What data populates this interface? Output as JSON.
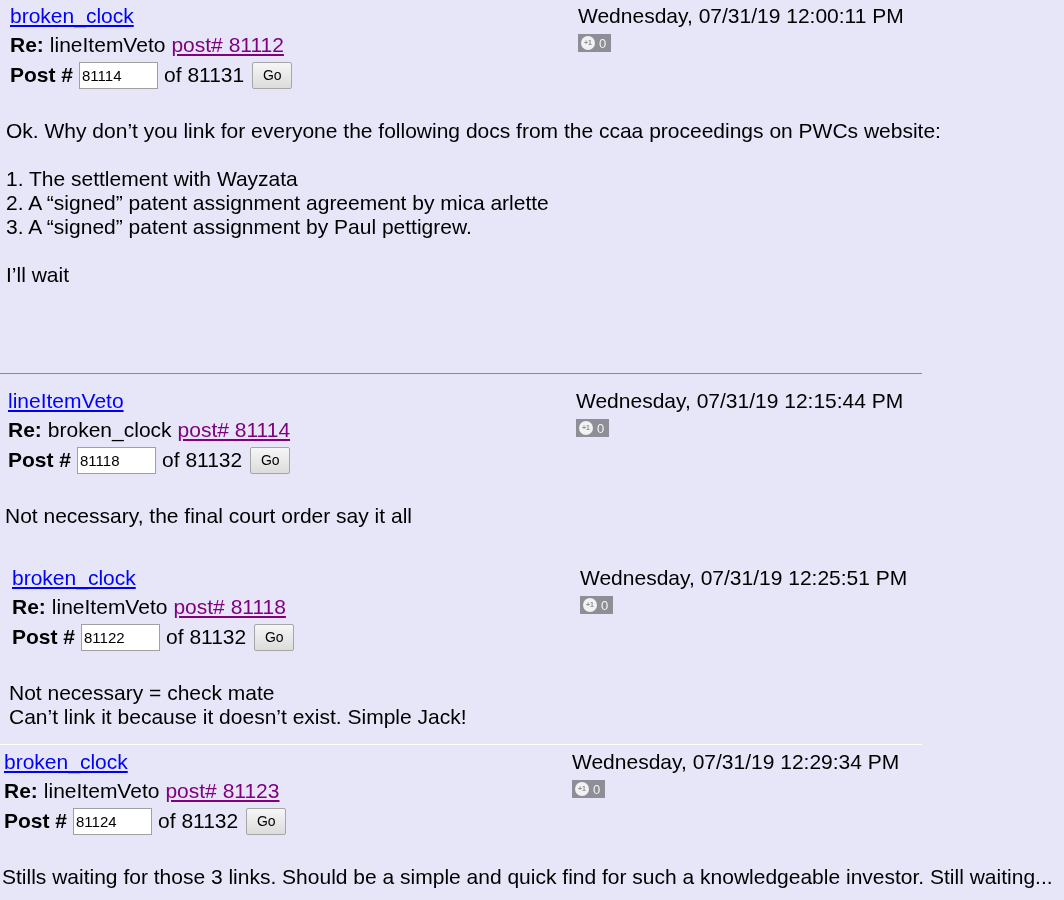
{
  "posts": [
    {
      "author": "broken_clock",
      "re_label": "Re:",
      "re_author": "lineItemVeto",
      "re_link": "post# 81112",
      "post_label": "Post #",
      "post_number": "81114",
      "of_text": "of 81131",
      "go": "Go",
      "date": "Wednesday, 07/31/19 12:00:11 PM",
      "plus_label": "+1",
      "plus_count": "0",
      "body": [
        [
          "Ok. Why don’t you link for everyone the following docs from the ccaa proceedings on PWCs website:"
        ],
        [
          "1. The settlement with Wayzata",
          "2. A “signed” patent assignment agreement by mica arlette",
          "3. A “signed” patent assignment by Paul pettigrew."
        ],
        [
          "I’ll wait"
        ]
      ],
      "divider": {
        "faint": false
      }
    },
    {
      "author": "lineItemVeto",
      "re_label": "Re:",
      "re_author": "broken_clock",
      "re_link": "post# 81114",
      "post_label": "Post #",
      "post_number": "81118",
      "of_text": "of 81132",
      "go": "Go",
      "date": "Wednesday, 07/31/19 12:15:44 PM",
      "plus_label": "+1",
      "plus_count": "0",
      "body": [
        [
          "Not necessary, the final court order say it all"
        ]
      ]
    },
    {
      "author": "broken_clock",
      "re_label": "Re:",
      "re_author": "lineItemVeto",
      "re_link": "post# 81118",
      "post_label": "Post #",
      "post_number": "81122",
      "of_text": "of 81132",
      "go": "Go",
      "date": "Wednesday, 07/31/19 12:25:51 PM",
      "plus_label": "+1",
      "plus_count": "0",
      "body": [
        [
          "Not necessary = check mate",
          "Can’t link it because it doesn’t exist. Simple Jack!"
        ]
      ],
      "divider": {
        "faint": true
      }
    },
    {
      "author": "broken_clock",
      "re_label": "Re:",
      "re_author": "lineItemVeto",
      "re_link": "post# 81123",
      "post_label": "Post #",
      "post_number": "81124",
      "of_text": "of 81132",
      "go": "Go",
      "date": "Wednesday, 07/31/19 12:29:34 PM",
      "plus_label": "+1",
      "plus_count": "0",
      "body": [
        [
          "Stills waiting for those 3 links. Should be a simple and quick find for such a knowledgeable investor. Still waiting..."
        ]
      ]
    }
  ]
}
